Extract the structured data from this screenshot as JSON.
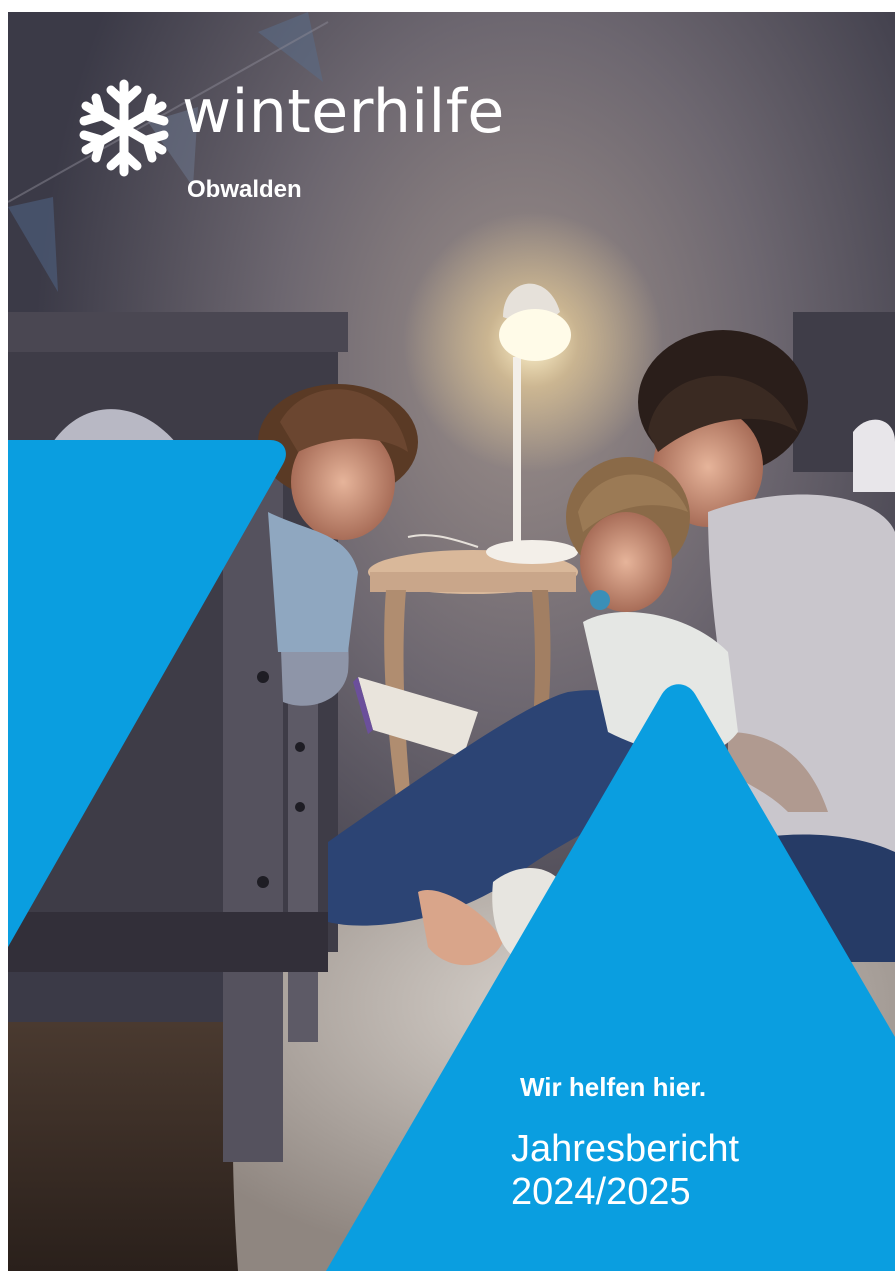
{
  "brand": {
    "logo_icon": "snowflake-icon",
    "name": "winterhilfe",
    "region": "Obwalden"
  },
  "cover": {
    "tagline": "Wir helfen hier.",
    "title_line1": "Jahresbericht",
    "title_line2": "2024/2025"
  },
  "colors": {
    "accent_blue": "#0a9ee0",
    "text_white": "#ffffff"
  }
}
